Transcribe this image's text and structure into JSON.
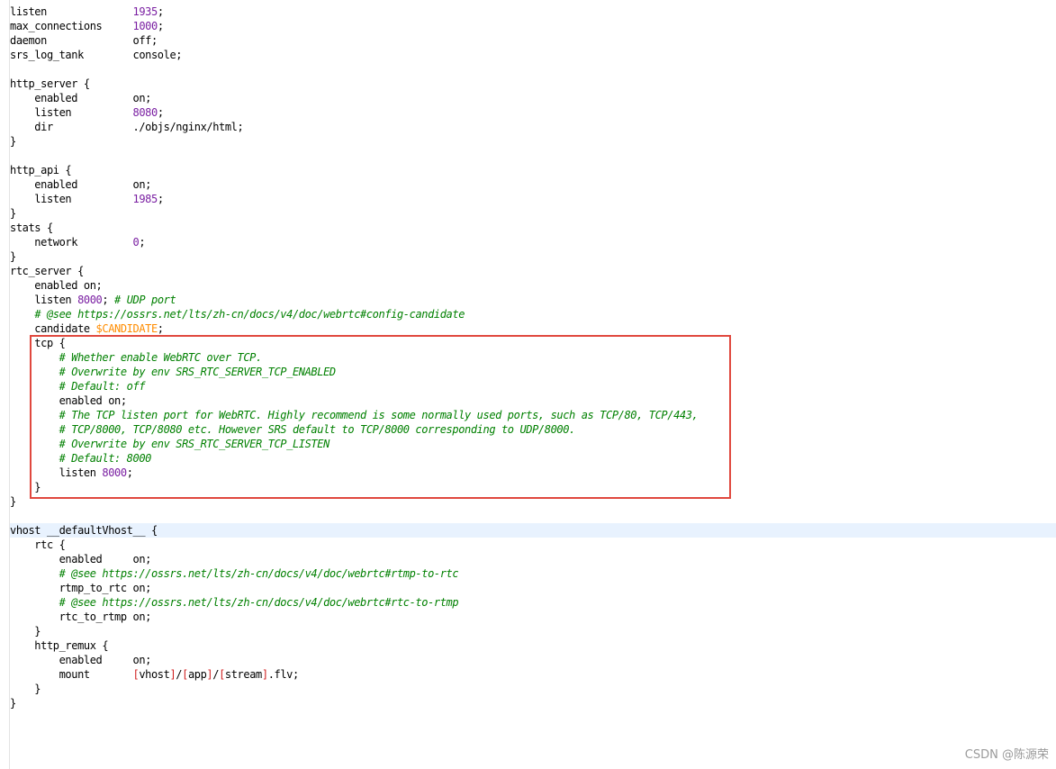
{
  "colors": {
    "number": "#7a1fa2",
    "variable": "#ff8c00",
    "bracket": "#d02020",
    "comment": "#008000",
    "highlight_box": "#e0483e",
    "current_line": "#e8f2fe"
  },
  "editor": {
    "lines": [
      {
        "tokens": [
          {
            "t": "listen              ",
            "k": "plain"
          },
          {
            "t": "1935",
            "k": "num"
          },
          {
            "t": ";",
            "k": "plain"
          }
        ]
      },
      {
        "tokens": [
          {
            "t": "max_connections     ",
            "k": "plain"
          },
          {
            "t": "1000",
            "k": "num"
          },
          {
            "t": ";",
            "k": "plain"
          }
        ]
      },
      {
        "tokens": [
          {
            "t": "daemon              off;",
            "k": "plain"
          }
        ]
      },
      {
        "tokens": [
          {
            "t": "srs_log_tank        console;",
            "k": "plain"
          }
        ]
      },
      {
        "tokens": []
      },
      {
        "tokens": [
          {
            "t": "http_server {",
            "k": "plain"
          }
        ]
      },
      {
        "tokens": [
          {
            "t": "    enabled         on;",
            "k": "plain"
          }
        ]
      },
      {
        "tokens": [
          {
            "t": "    listen          ",
            "k": "plain"
          },
          {
            "t": "8080",
            "k": "num"
          },
          {
            "t": ";",
            "k": "plain"
          }
        ]
      },
      {
        "tokens": [
          {
            "t": "    dir             ./objs/nginx/html;",
            "k": "plain"
          }
        ]
      },
      {
        "tokens": [
          {
            "t": "}",
            "k": "plain"
          }
        ]
      },
      {
        "tokens": []
      },
      {
        "tokens": [
          {
            "t": "http_api {",
            "k": "plain"
          }
        ]
      },
      {
        "tokens": [
          {
            "t": "    enabled         on;",
            "k": "plain"
          }
        ]
      },
      {
        "tokens": [
          {
            "t": "    listen          ",
            "k": "plain"
          },
          {
            "t": "1985",
            "k": "num"
          },
          {
            "t": ";",
            "k": "plain"
          }
        ]
      },
      {
        "tokens": [
          {
            "t": "}",
            "k": "plain"
          }
        ]
      },
      {
        "tokens": [
          {
            "t": "stats {",
            "k": "plain"
          }
        ]
      },
      {
        "tokens": [
          {
            "t": "    network         ",
            "k": "plain"
          },
          {
            "t": "0",
            "k": "num"
          },
          {
            "t": ";",
            "k": "plain"
          }
        ]
      },
      {
        "tokens": [
          {
            "t": "}",
            "k": "plain"
          }
        ]
      },
      {
        "tokens": [
          {
            "t": "rtc_server {",
            "k": "plain"
          }
        ]
      },
      {
        "tokens": [
          {
            "t": "    enabled on;",
            "k": "plain"
          }
        ]
      },
      {
        "tokens": [
          {
            "t": "    listen ",
            "k": "plain"
          },
          {
            "t": "8000",
            "k": "num"
          },
          {
            "t": "; ",
            "k": "plain"
          },
          {
            "t": "# UDP port",
            "k": "comment"
          }
        ]
      },
      {
        "tokens": [
          {
            "t": "    ",
            "k": "plain"
          },
          {
            "t": "# @see https://ossrs.net/lts/zh-cn/docs/v4/doc/webrtc#config-candidate",
            "k": "comment"
          }
        ]
      },
      {
        "tokens": [
          {
            "t": "    candidate ",
            "k": "plain"
          },
          {
            "t": "$CANDIDATE",
            "k": "var"
          },
          {
            "t": ";",
            "k": "plain"
          }
        ]
      },
      {
        "tokens": [
          {
            "t": "    tcp {",
            "k": "plain"
          }
        ]
      },
      {
        "tokens": [
          {
            "t": "        ",
            "k": "plain"
          },
          {
            "t": "# Whether enable WebRTC over TCP.",
            "k": "comment"
          }
        ]
      },
      {
        "tokens": [
          {
            "t": "        ",
            "k": "plain"
          },
          {
            "t": "# Overwrite by env SRS_RTC_SERVER_TCP_ENABLED",
            "k": "comment"
          }
        ]
      },
      {
        "tokens": [
          {
            "t": "        ",
            "k": "plain"
          },
          {
            "t": "# Default: off",
            "k": "comment"
          }
        ]
      },
      {
        "tokens": [
          {
            "t": "        enabled on;",
            "k": "plain"
          }
        ]
      },
      {
        "tokens": [
          {
            "t": "        ",
            "k": "plain"
          },
          {
            "t": "# The TCP listen port for WebRTC. Highly recommend is some normally used ports, such as TCP/80, TCP/443,",
            "k": "comment"
          }
        ]
      },
      {
        "tokens": [
          {
            "t": "        ",
            "k": "plain"
          },
          {
            "t": "# TCP/8000, TCP/8080 etc. However SRS default to TCP/8000 corresponding to UDP/8000.",
            "k": "comment"
          }
        ]
      },
      {
        "tokens": [
          {
            "t": "        ",
            "k": "plain"
          },
          {
            "t": "# Overwrite by env SRS_RTC_SERVER_TCP_LISTEN",
            "k": "comment"
          }
        ]
      },
      {
        "tokens": [
          {
            "t": "        ",
            "k": "plain"
          },
          {
            "t": "# Default: 8000",
            "k": "comment"
          }
        ]
      },
      {
        "tokens": [
          {
            "t": "        listen ",
            "k": "plain"
          },
          {
            "t": "8000",
            "k": "num"
          },
          {
            "t": ";",
            "k": "plain"
          }
        ]
      },
      {
        "tokens": [
          {
            "t": "    }",
            "k": "plain"
          }
        ]
      },
      {
        "tokens": [
          {
            "t": "}",
            "k": "plain"
          }
        ]
      },
      {
        "tokens": []
      },
      {
        "current": true,
        "tokens": [
          {
            "t": "vhost __defaultVhost__ {",
            "k": "plain"
          }
        ]
      },
      {
        "tokens": [
          {
            "t": "    rtc {",
            "k": "plain"
          }
        ]
      },
      {
        "tokens": [
          {
            "t": "        enabled     on;",
            "k": "plain"
          }
        ]
      },
      {
        "tokens": [
          {
            "t": "        ",
            "k": "plain"
          },
          {
            "t": "# @see https://ossrs.net/lts/zh-cn/docs/v4/doc/webrtc#rtmp-to-rtc",
            "k": "comment"
          }
        ]
      },
      {
        "tokens": [
          {
            "t": "        rtmp_to_rtc on;",
            "k": "plain"
          }
        ]
      },
      {
        "tokens": [
          {
            "t": "        ",
            "k": "plain"
          },
          {
            "t": "# @see https://ossrs.net/lts/zh-cn/docs/v4/doc/webrtc#rtc-to-rtmp",
            "k": "comment"
          }
        ]
      },
      {
        "tokens": [
          {
            "t": "        rtc_to_rtmp on;",
            "k": "plain"
          }
        ]
      },
      {
        "tokens": [
          {
            "t": "    }",
            "k": "plain"
          }
        ]
      },
      {
        "tokens": [
          {
            "t": "    http_remux {",
            "k": "plain"
          }
        ]
      },
      {
        "tokens": [
          {
            "t": "        enabled     on;",
            "k": "plain"
          }
        ]
      },
      {
        "tokens": [
          {
            "t": "        mount       ",
            "k": "plain"
          },
          {
            "t": "[",
            "k": "bracket"
          },
          {
            "t": "vhost",
            "k": "plain"
          },
          {
            "t": "]",
            "k": "bracket"
          },
          {
            "t": "/",
            "k": "plain"
          },
          {
            "t": "[",
            "k": "bracket"
          },
          {
            "t": "app",
            "k": "plain"
          },
          {
            "t": "]",
            "k": "bracket"
          },
          {
            "t": "/",
            "k": "plain"
          },
          {
            "t": "[",
            "k": "bracket"
          },
          {
            "t": "stream",
            "k": "plain"
          },
          {
            "t": "]",
            "k": "bracket"
          },
          {
            "t": ".flv;",
            "k": "plain"
          }
        ]
      },
      {
        "tokens": [
          {
            "t": "    }",
            "k": "plain"
          }
        ]
      },
      {
        "tokens": [
          {
            "t": "}",
            "k": "plain"
          }
        ]
      }
    ]
  },
  "watermark": {
    "text": "CSDN @陈源荣"
  }
}
